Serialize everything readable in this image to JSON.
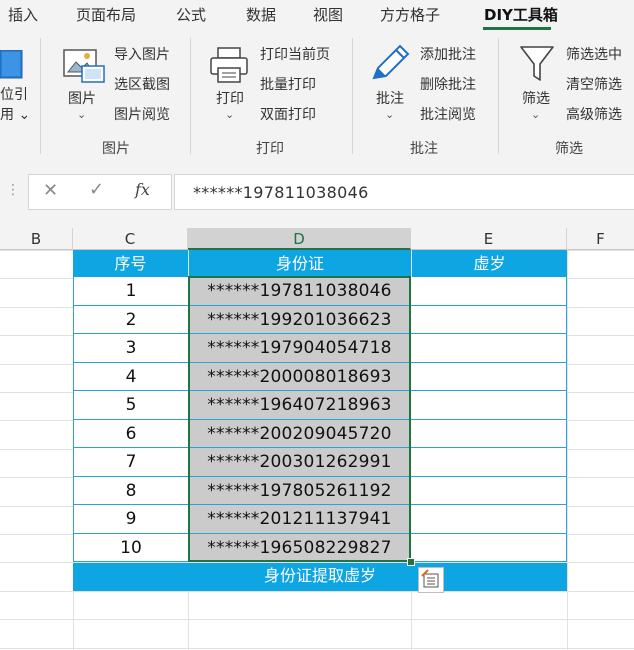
{
  "ribbon_tabs": [
    {
      "label": "插入"
    },
    {
      "label": "页面布局"
    },
    {
      "label": "公式"
    },
    {
      "label": "数据"
    },
    {
      "label": "视图"
    },
    {
      "label": "方方格子"
    },
    {
      "label": "DIY工具箱",
      "active": true
    }
  ],
  "ribbon": {
    "partial_left": {
      "line1": "位引",
      "line2": "用 ⌄"
    },
    "picture_group": {
      "label": "图片",
      "big_button": "图片",
      "items": [
        "导入图片",
        "选区截图",
        "图片阅览"
      ]
    },
    "print_group": {
      "label": "打印",
      "big_button": "打印",
      "items": [
        "打印当前页",
        "批量打印",
        "双面打印"
      ]
    },
    "comment_group": {
      "label": "批注",
      "big_button": "批注",
      "items": [
        "添加批注",
        "删除批注",
        "批注阅览"
      ]
    },
    "filter_group": {
      "label": "筛选",
      "big_button": "筛选",
      "items": [
        "筛选选中",
        "清空筛选",
        "高级筛选"
      ]
    }
  },
  "formula_bar": {
    "cancel_icon": "close-icon",
    "enter_icon": "check-icon",
    "fx_label": "fx",
    "value": "******197811038046"
  },
  "columns": [
    "B",
    "C",
    "D",
    "E",
    "F"
  ],
  "selected_column": "D",
  "table": {
    "headers": [
      "序号",
      "身份证",
      "虚岁"
    ],
    "rows": [
      {
        "no": "1",
        "id": "******197811038046",
        "age": ""
      },
      {
        "no": "2",
        "id": "******199201036623",
        "age": ""
      },
      {
        "no": "3",
        "id": "******197904054718",
        "age": ""
      },
      {
        "no": "4",
        "id": "******200008018693",
        "age": ""
      },
      {
        "no": "5",
        "id": "******196407218963",
        "age": ""
      },
      {
        "no": "6",
        "id": "******200209045720",
        "age": ""
      },
      {
        "no": "7",
        "id": "******200301262991",
        "age": ""
      },
      {
        "no": "8",
        "id": "******197805261192",
        "age": ""
      },
      {
        "no": "9",
        "id": "******201211137941",
        "age": ""
      },
      {
        "no": "10",
        "id": "******196508229827",
        "age": ""
      }
    ],
    "footer": "身份证提取虚岁"
  },
  "colors": {
    "accent_green": "#217346",
    "table_header_blue": "#0ea5e3",
    "selection_gray": "#cbcbcb"
  }
}
